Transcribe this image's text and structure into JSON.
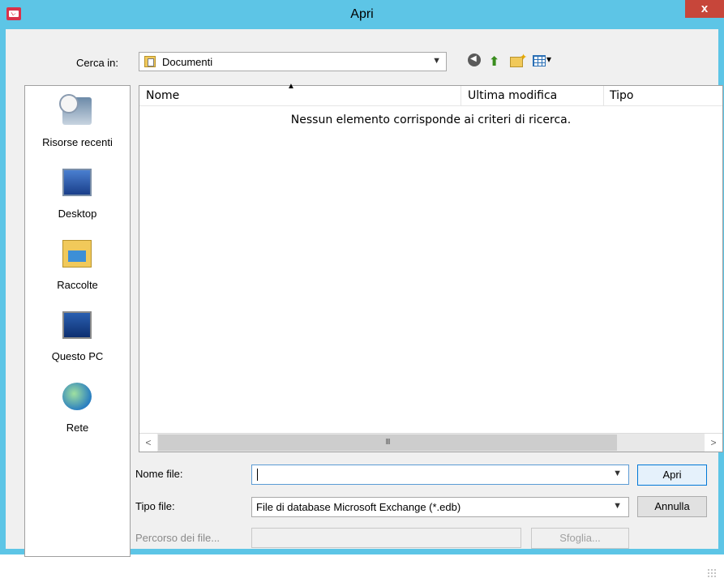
{
  "window": {
    "title": "Apri",
    "close_label": "x"
  },
  "toolbar": {
    "lookin_label": "Cerca in:",
    "lookin_value": "Documenti",
    "icons": [
      "back-icon",
      "up-folder-icon",
      "new-folder-icon",
      "view-menu-icon"
    ]
  },
  "places": [
    {
      "label": "Risorse recenti",
      "icon": "recent-places-icon"
    },
    {
      "label": "Desktop",
      "icon": "desktop-icon"
    },
    {
      "label": "Raccolte",
      "icon": "libraries-icon"
    },
    {
      "label": "Questo PC",
      "icon": "this-pc-icon"
    },
    {
      "label": "Rete",
      "icon": "network-icon"
    }
  ],
  "filelist": {
    "columns": [
      "Nome",
      "Ultima modifica",
      "Tipo"
    ],
    "empty_message": "Nessun elemento corrisponde ai criteri di ricerca.",
    "scroll_thumb": "III"
  },
  "form": {
    "filename_label": "Nome file:",
    "filename_value": "",
    "filetype_label": "Tipo file:",
    "filetype_value": "File di database Microsoft Exchange (*.edb)",
    "path_label": "Percorso dei file...",
    "path_value": ""
  },
  "buttons": {
    "open": "Apri",
    "cancel": "Annulla",
    "browse": "Sfoglia..."
  },
  "colors": {
    "titlebar": "#5dc5e6",
    "close": "#c7463a",
    "primary_border": "#0078d7"
  }
}
